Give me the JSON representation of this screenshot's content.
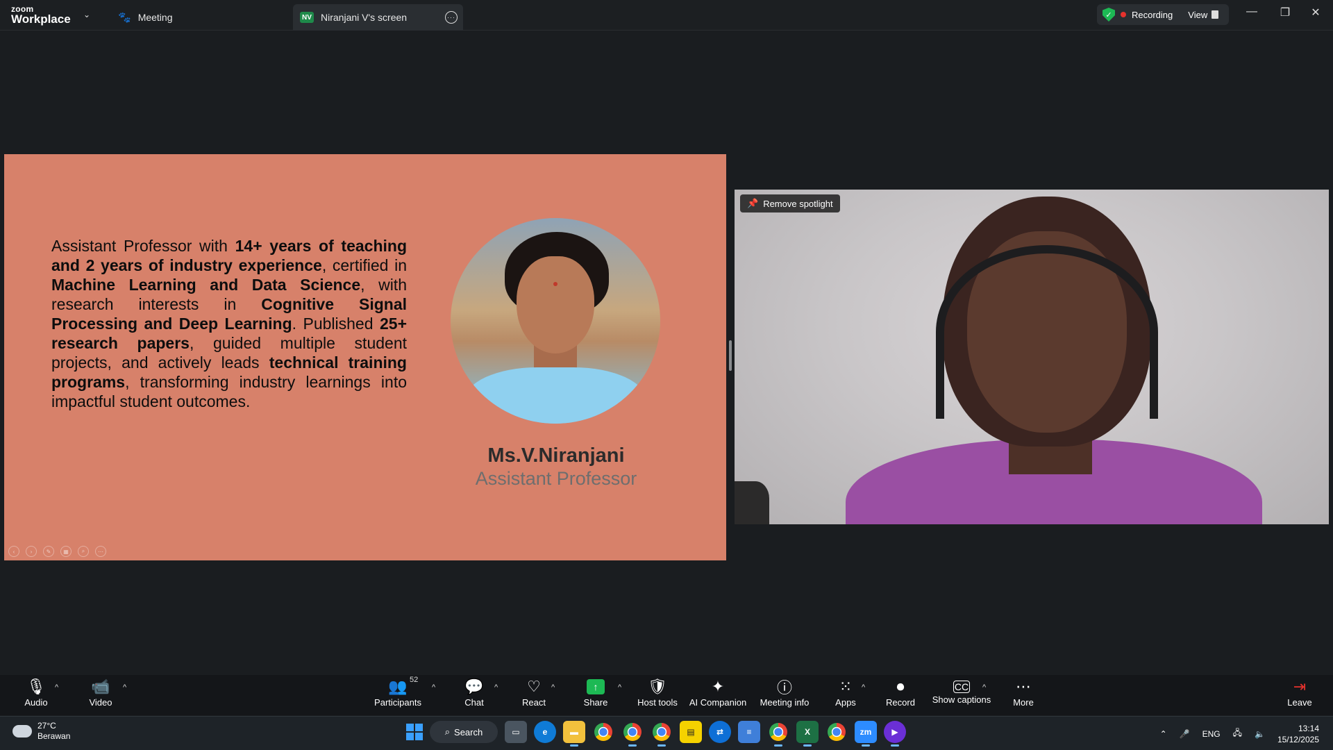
{
  "titlebar": {
    "brand_top": "zoom",
    "brand_bottom": "Workplace",
    "tab_meeting": "Meeting",
    "tab_screen_initials": "NV",
    "tab_screen": "Niranjani V's screen",
    "recording": "Recording",
    "view": "View"
  },
  "slide": {
    "bio_1": "Assistant Professor with ",
    "bio_b1": "14+ years of teaching and 2 years of industry experience",
    "bio_2": ", certified in ",
    "bio_b2": "Machine Learning and Data Science",
    "bio_3": ", with research interests in ",
    "bio_b3": "Cognitive Signal Processing and Deep Learning",
    "bio_4": ". Published ",
    "bio_b4": "25+ research papers",
    "bio_5": ", guided multiple student projects, and actively leads ",
    "bio_b5": "technical training programs",
    "bio_6": ", transforming industry learnings into impactful student outcomes.",
    "name": "Ms.V.Niranjani",
    "role": "Assistant Professor"
  },
  "video": {
    "spotlight_label": "Remove spotlight"
  },
  "toolbar": {
    "audio": "Audio",
    "video": "Video",
    "participants": "Participants",
    "participants_count": "52",
    "chat": "Chat",
    "react": "React",
    "share": "Share",
    "host_tools": "Host tools",
    "ai_companion": "AI Companion",
    "meeting_info": "Meeting info",
    "apps": "Apps",
    "record": "Record",
    "show_captions": "Show captions",
    "more": "More",
    "leave": "Leave"
  },
  "taskbar": {
    "temperature": "27°C",
    "weather": "Berawan",
    "search": "Search",
    "language": "ENG",
    "time": "13:14",
    "date": "15/12/2025"
  },
  "colors": {
    "slide_bg": "#d7816a",
    "accent_green": "#1db954",
    "record_red": "#e5322d"
  }
}
